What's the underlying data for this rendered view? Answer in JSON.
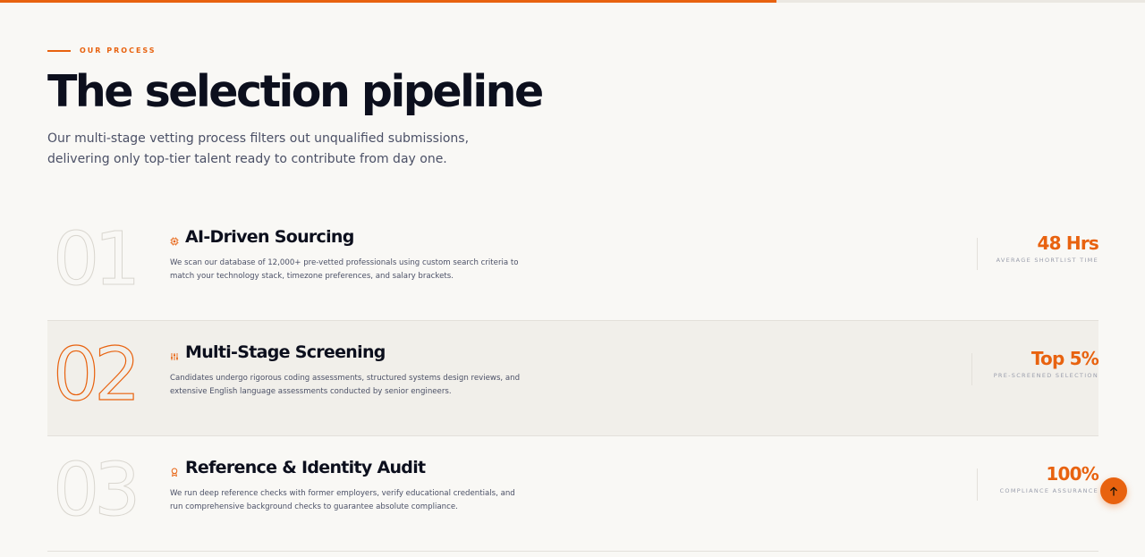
{
  "scroll_progress": 0.678,
  "accent_color": "#e8620f",
  "eyebrow": "OUR PROCESS",
  "title": "The selection pipeline",
  "subtitle": "Our multi-stage vetting process filters out unqualified submissions, delivering only top-tier talent ready to contribute from day one.",
  "stages": [
    {
      "number": "01",
      "icon": "chip-icon",
      "title": "AI-Driven Sourcing",
      "description": "We scan our database of 12,000+ pre-vetted professionals using custom search criteria to match your technology stack, timezone preferences, and salary brackets.",
      "metric_value": "48 Hrs",
      "metric_label": "AVERAGE SHORTLIST TIME",
      "active": false
    },
    {
      "number": "02",
      "icon": "sliders-icon",
      "title": "Multi-Stage Screening",
      "description": "Candidates undergo rigorous coding assessments, structured systems design reviews, and extensive English language assessments conducted by senior engineers.",
      "metric_value": "Top 5%",
      "metric_label": "PRE-SCREENED SELECTION",
      "active": true
    },
    {
      "number": "03",
      "icon": "badge-icon",
      "title": "Reference & Identity Audit",
      "description": "We run deep reference checks with former employers, verify educational credentials, and run comprehensive background checks to guarantee absolute compliance.",
      "metric_value": "100%",
      "metric_label": "COMPLIANCE ASSURANCE",
      "active": false
    }
  ],
  "back_to_top_icon": "arrow-up-icon"
}
